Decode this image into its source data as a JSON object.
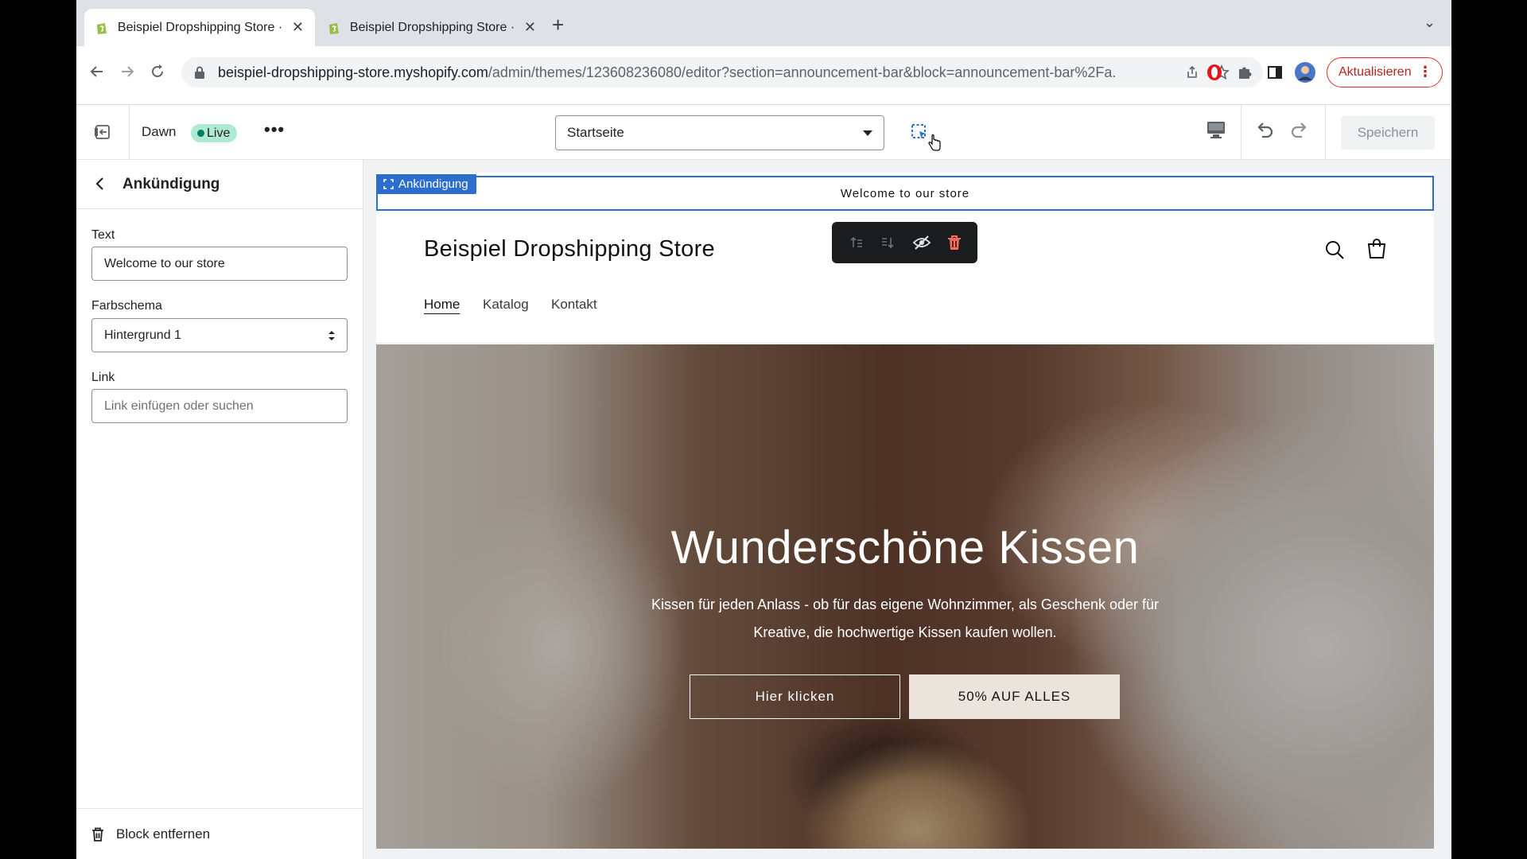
{
  "browser": {
    "tabs": [
      {
        "title": "Beispiel Dropshipping Store · D",
        "close": "✕"
      },
      {
        "title": "Beispiel Dropshipping Store · E",
        "close": "✕"
      }
    ],
    "new_tab": "+",
    "tab_menu": "⌄",
    "url_host": "beispiel-dropshipping-store.myshopify.com",
    "url_path": "/admin/themes/123608236080/editor?section=announcement-bar&block=announcement-bar%2Fa...",
    "update_label": "Aktualisieren",
    "update_menu": "⋮"
  },
  "editor": {
    "theme_name": "Dawn",
    "live_badge": "Live",
    "more": "•••",
    "page_select": "Startseite",
    "save_label": "Speichern"
  },
  "panel": {
    "title": "Ankündigung",
    "fields": [
      {
        "label": "Text",
        "value": "Welcome to our store"
      },
      {
        "label": "Farbschema",
        "value": "Hintergrund 1"
      },
      {
        "label": "Link",
        "placeholder": "Link einfügen oder suchen"
      }
    ],
    "remove_block": "Block entfernen"
  },
  "store": {
    "announcement_tag": "Ankündigung",
    "announcement_text": "Welcome to our store",
    "store_name": "Beispiel Dropshipping Store",
    "nav": [
      "Home",
      "Katalog",
      "Kontakt"
    ],
    "hero_title": "Wunderschöne Kissen",
    "hero_text": "Kissen für jeden Anlass - ob für das eigene Wohnzimmer, als Geschenk oder für Kreative, die hochwertige Kissen kaufen wollen.",
    "hero_button_primary": "Hier klicken",
    "hero_button_secondary": "50% AUF ALLES"
  },
  "colors": {
    "accent_blue": "#2c6ecb",
    "live_green": "#aee9d1",
    "update_red": "#d93025"
  }
}
